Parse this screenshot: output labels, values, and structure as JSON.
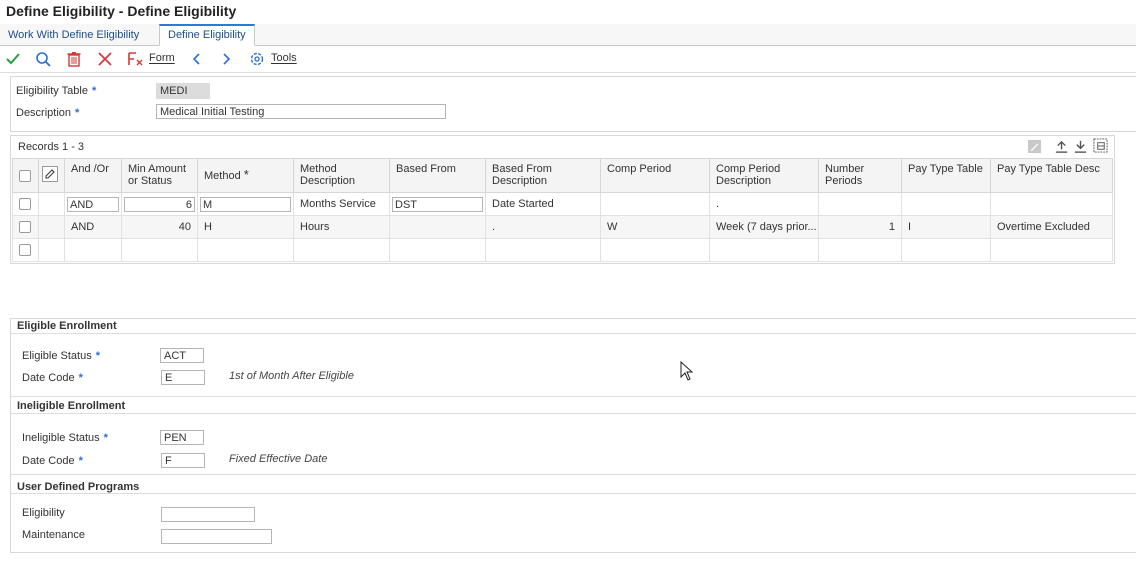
{
  "window": {
    "title": "Define Eligibility - Define Eligibility"
  },
  "tabs": [
    {
      "label": "Work With Define Eligibility"
    },
    {
      "label": "Define Eligibility"
    }
  ],
  "toolbar": {
    "form_label": "Form",
    "tools_label": "Tools"
  },
  "header": {
    "eligibility_table_label": "Eligibility Table",
    "eligibility_table_value": "MEDI",
    "description_label": "Description",
    "description_value": "Medical Initial Testing"
  },
  "grid": {
    "records_label": "Records 1 - 3",
    "columns": [
      "And /Or",
      "Min Amount or Status",
      "Method",
      "Method Description",
      "Based From",
      "Based From Description",
      "Comp Period",
      "Comp Period Description",
      "Number Periods",
      "Pay Type Table",
      "Pay Type Table Desc"
    ],
    "rows": [
      [
        "AND",
        "6",
        "M",
        "Months Service",
        "DST",
        "Date Started",
        "",
        ".",
        "",
        "",
        ""
      ],
      [
        "AND",
        "40",
        "H",
        "Hours",
        "",
        ".",
        "W",
        "Week (7 days prior...",
        "1",
        "I",
        "Overtime Excluded"
      ]
    ]
  },
  "eligible": {
    "title": "Eligible Enrollment",
    "status_label": "Eligible Status",
    "status_value": "ACT",
    "date_code_label": "Date Code",
    "date_code_value": "E",
    "date_code_desc": "1st of Month After Eligible"
  },
  "ineligible": {
    "title": "Ineligible Enrollment",
    "status_label": "Ineligible Status",
    "status_value": "PEN",
    "date_code_label": "Date Code",
    "date_code_value": "F",
    "date_code_desc": "Fixed Effective Date"
  },
  "user_programs": {
    "title": "User Defined Programs",
    "eligibility_label": "Eligibility",
    "eligibility_value": "",
    "maintenance_label": "Maintenance",
    "maintenance_value": ""
  },
  "required_mark": "*",
  "colors": {
    "accent": "#2b6fd0",
    "ok": "#2e9e3a",
    "danger": "#d23a3a"
  }
}
